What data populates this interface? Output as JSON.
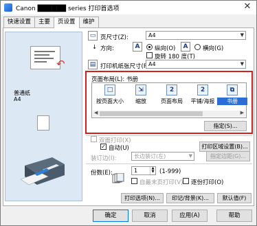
{
  "window": {
    "title": "Canon ██████ series 打印首选项"
  },
  "tabs": [
    {
      "label": "快速设置"
    },
    {
      "label": "主要"
    },
    {
      "label": "页设置"
    },
    {
      "label": "维护"
    }
  ],
  "preview": {
    "paper_label": "普通纸",
    "paper_size": "A4"
  },
  "page_size": {
    "label": "页尺寸(Z):",
    "value": "A4"
  },
  "orientation": {
    "label": "方向:",
    "portrait": "纵向(O)",
    "landscape": "横向(G)",
    "rotate": "旋转 180 度(T)"
  },
  "printer_paper_size": {
    "label": "打印机纸张尺寸(R):",
    "value": "A4"
  },
  "page_layout": {
    "label": "页面布局(L): 书册",
    "items": [
      {
        "label": "按页面大小",
        "icon": "□"
      },
      {
        "label": "缩放",
        "icon": "⇲"
      },
      {
        "label": "页面布局",
        "icon": "2"
      },
      {
        "label": "平铺/海报",
        "icon": "2"
      },
      {
        "label": "书册",
        "icon": "⧉"
      }
    ],
    "specify_button": "指定(S)..."
  },
  "duplex": {
    "label": "双面打印(X)",
    "auto": "自动(U)",
    "print_area_button": "打印区域设置(B)...",
    "stapling_label": "装订边(I):",
    "stapling_value": "长边装订(左)",
    "margin_button": "指定边距(G)..."
  },
  "copies": {
    "label": "份数(E):",
    "value": "1",
    "range": "(1-999)",
    "reverse": "自最末页打印(V)",
    "collate": "逐份打印(O)"
  },
  "bottom_row": {
    "print_options": "打印选项(N)...",
    "stamp_background": "印记/背景(K)...",
    "defaults": "默认值(F)"
  },
  "footer": {
    "ok": "确定",
    "cancel": "取消",
    "apply": "应用(A)",
    "help": "帮助"
  }
}
